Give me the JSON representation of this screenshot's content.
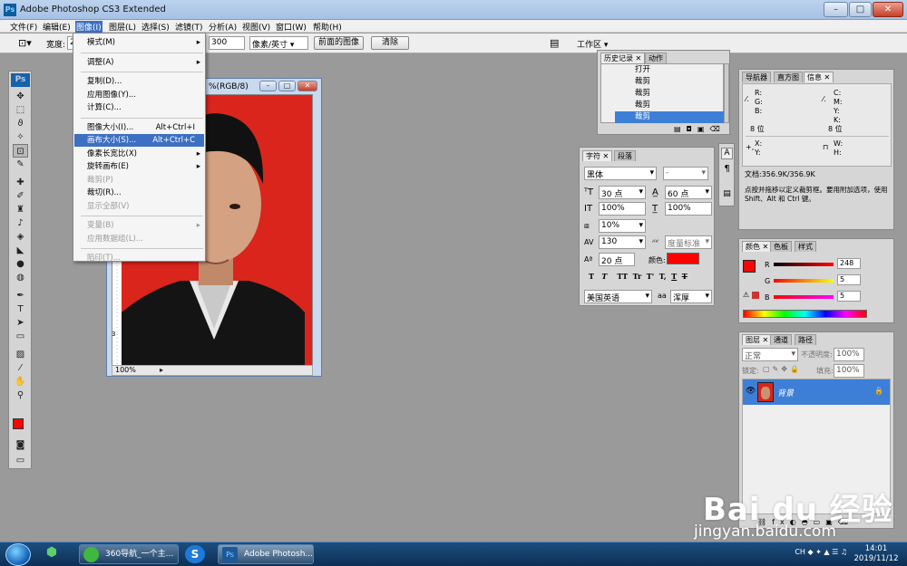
{
  "window": {
    "title": "Adobe Photoshop CS3 Extended",
    "min": "–",
    "max": "□",
    "close": "✕"
  },
  "menubar": [
    "文件(F)",
    "编辑(E)",
    "图像(I)",
    "图层(L)",
    "选择(S)",
    "滤镜(T)",
    "分析(A)",
    "视图(V)",
    "窗口(W)",
    "帮助(H)"
  ],
  "options": {
    "width_label": "宽度:",
    "width_value": "2",
    "resolution_value": "300",
    "unit": "像素/英寸",
    "front_image": "前面的图像",
    "clear": "清除",
    "workspace": "工作区"
  },
  "document": {
    "title": "%(RGB/8)",
    "zoom": "100%",
    "ruler_a": "2",
    "ruler_b": "3"
  },
  "image_menu": [
    {
      "label": "模式(M)",
      "shortcut": "",
      "arrow": "▸",
      "state": "normal"
    },
    {
      "sep": true
    },
    {
      "label": "调整(A)",
      "shortcut": "",
      "arrow": "▸",
      "state": "normal"
    },
    {
      "sep": true
    },
    {
      "label": "复制(D)...",
      "shortcut": "",
      "arrow": "",
      "state": "normal"
    },
    {
      "label": "应用图像(Y)...",
      "shortcut": "",
      "arrow": "",
      "state": "normal"
    },
    {
      "label": "计算(C)...",
      "shortcut": "",
      "arrow": "",
      "state": "normal"
    },
    {
      "sep": true
    },
    {
      "label": "图像大小(I)...",
      "shortcut": "Alt+Ctrl+I",
      "arrow": "",
      "state": "normal"
    },
    {
      "label": "画布大小(S)...",
      "shortcut": "Alt+Ctrl+C",
      "arrow": "",
      "state": "hl"
    },
    {
      "label": "像素长宽比(X)",
      "shortcut": "",
      "arrow": "▸",
      "state": "normal"
    },
    {
      "label": "旋转画布(E)",
      "shortcut": "",
      "arrow": "▸",
      "state": "normal"
    },
    {
      "label": "裁剪(P)",
      "shortcut": "",
      "arrow": "",
      "state": "dis"
    },
    {
      "label": "裁切(R)...",
      "shortcut": "",
      "arrow": "",
      "state": "normal"
    },
    {
      "label": "显示全部(V)",
      "shortcut": "",
      "arrow": "",
      "state": "dis"
    },
    {
      "sep": true
    },
    {
      "label": "变量(B)",
      "shortcut": "",
      "arrow": "▸",
      "state": "dis"
    },
    {
      "label": "应用数据组(L)...",
      "shortcut": "",
      "arrow": "",
      "state": "dis"
    },
    {
      "sep": true
    },
    {
      "label": "陷印(T)...",
      "shortcut": "",
      "arrow": "",
      "state": "dis"
    }
  ],
  "history": {
    "tabs": [
      "历史记录",
      "动作"
    ],
    "items": [
      "打开",
      "裁剪",
      "裁剪",
      "裁剪",
      "裁剪"
    ]
  },
  "character": {
    "tabs": [
      "字符",
      "段落"
    ],
    "font": "黑体",
    "style": "-",
    "size": "30 点",
    "leading": "60 点",
    "vscale": "100%",
    "hscale": "100%",
    "tracking_ratio": "10%",
    "tracking": "130",
    "kerning": "度量标准",
    "baseline": "20 点",
    "color_label": "颜色:",
    "language": "美国英语",
    "antialias_label": "aa",
    "antialias": "浑厚",
    "styles": [
      "T",
      "T",
      "TT",
      "Tr",
      "T'",
      "T,",
      "T",
      "T"
    ],
    "color": "#ff0000"
  },
  "info": {
    "tabs": [
      "导航器",
      "直方图",
      "信息"
    ],
    "rgb": [
      "R:",
      "G:",
      "B:"
    ],
    "cmyk": [
      "C:",
      "M:",
      "Y:",
      "K:"
    ],
    "bits": [
      "8 位",
      "8 位"
    ],
    "xy": [
      "X:",
      "Y:"
    ],
    "wh": [
      "W:",
      "H:"
    ],
    "doc": "文档:356.9K/356.9K",
    "hint": "点按并拖移以定义裁剪框。要用附加选项，使用 Shift、Alt 和 Ctrl 键。"
  },
  "color_panel": {
    "tabs": [
      "颜色",
      "色板",
      "样式"
    ],
    "r_label": "R",
    "g_label": "G",
    "b_label": "B",
    "r": "248",
    "g": "5",
    "b": "5",
    "fg": "#f80505"
  },
  "layers": {
    "tabs": [
      "图层",
      "通道",
      "路径"
    ],
    "mode": "正常",
    "opacity_label": "不透明度:",
    "opacity": "100%",
    "lock_label": "锁定:",
    "fill_label": "填充:",
    "fill": "100%",
    "layer_name": "背景"
  },
  "taskbar": {
    "items": [
      "360导航_一个主...",
      "Adobe Photosh..."
    ],
    "tray": "CH",
    "time": "14:01",
    "date": "2019/11/12"
  },
  "watermark": {
    "brand": "Bai du 经验",
    "url": "jingyan.baidu.com"
  }
}
